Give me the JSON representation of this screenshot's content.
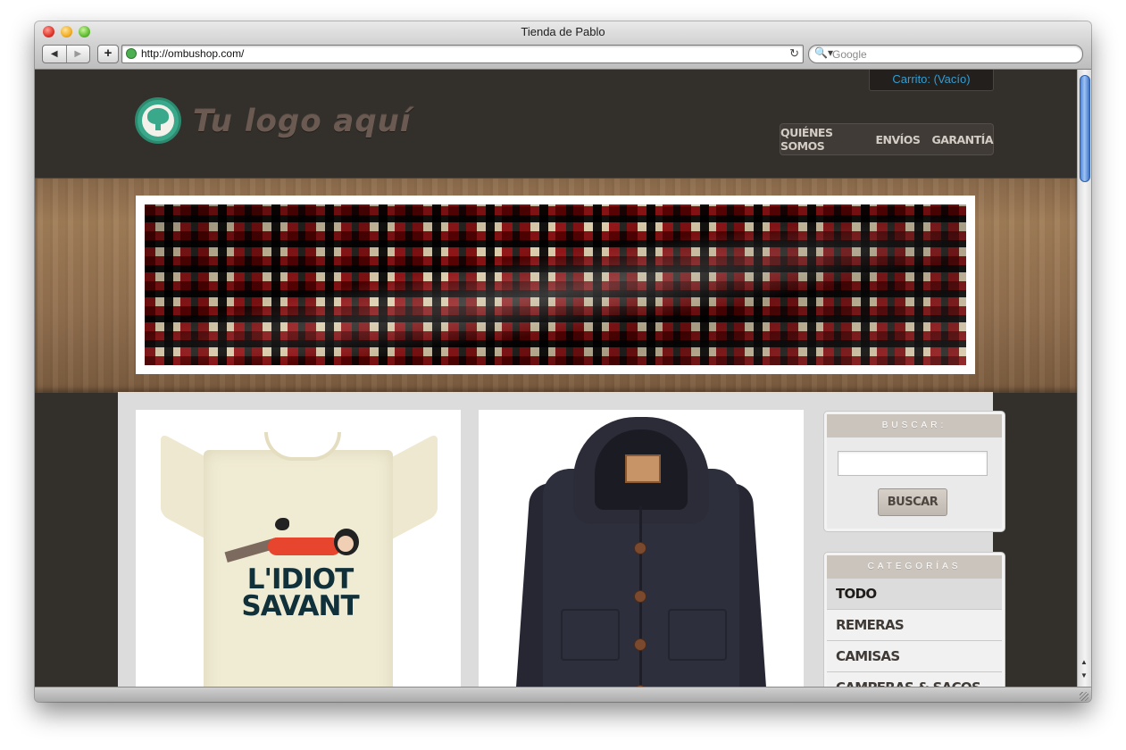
{
  "browser": {
    "window_title": "Tienda de Pablo",
    "back_label": "◀",
    "forward_label": "▶",
    "add_label": "+",
    "url": "http://ombushop.com/",
    "reload_icon": "↻",
    "search_placeholder": "Google",
    "search_icon": "🔍▾"
  },
  "header": {
    "cart_label": "Carrito: (Vacío)",
    "logo_text": "Tu logo aquí",
    "nav": [
      "QUIÉNES SOMOS",
      "ENVÍOS",
      "GARANTÍA"
    ]
  },
  "products": [
    {
      "print_line1": "L'IDIOT",
      "print_line2": "SAVANT"
    },
    {}
  ],
  "sidebar": {
    "search": {
      "heading": "BUSCAR:",
      "button_label": "BUSCAR",
      "input_value": ""
    },
    "categories": {
      "heading": "CATEGORÍAS",
      "items": [
        "TODO",
        "REMERAS",
        "CAMISAS",
        "CAMPERAS & SACOS"
      ]
    }
  },
  "colors": {
    "header_bg": "#332f2b",
    "cart_link": "#2e9fd6",
    "logo_green": "#3aa88a",
    "sidebar_head": "#cbc4bc"
  }
}
